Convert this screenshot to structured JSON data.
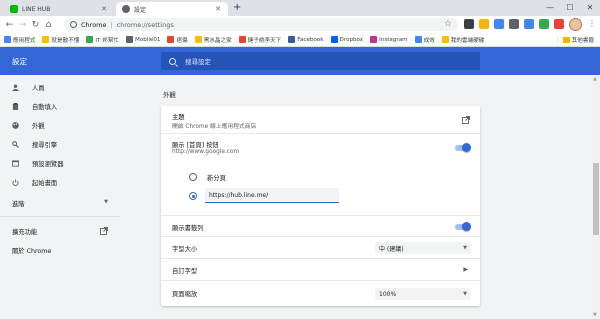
{
  "tabs": [
    {
      "title": "LINE HUB",
      "favicon_color": "#00b900"
    },
    {
      "title": "設定",
      "favicon_color": "#5f6368"
    }
  ],
  "toolbar": {
    "omnibox_site": "Chrome",
    "omnibox_url": "chrome://settings"
  },
  "bookmarks": [
    {
      "label": "應用程式",
      "color": "#4285f4"
    },
    {
      "label": "就是散不懂",
      "color": "#fbbc04"
    },
    {
      "label": "IT 邦幫忙",
      "color": "#34a853"
    },
    {
      "label": "Mobile01",
      "color": "#5f6368"
    },
    {
      "label": "痞傷",
      "color": "#ea4335"
    },
    {
      "label": "黑水晶之家",
      "color": "#fbbc04"
    },
    {
      "label": "鏈子桃李天下",
      "color": "#ea4335"
    },
    {
      "label": "Facebook",
      "color": "#3b5998"
    },
    {
      "label": "Dropbox",
      "color": "#0061ff"
    },
    {
      "label": "Instagram",
      "color": "#c13584"
    },
    {
      "label": "成效",
      "color": "#4285f4"
    },
    {
      "label": "我的雲端硬碟",
      "color": "#fbbc04"
    }
  ],
  "bookmarks_other": "其他書籤",
  "header": {
    "title": "設定",
    "search_placeholder": "搜尋設定"
  },
  "sidebar": {
    "items": [
      {
        "label": "人員",
        "icon": "person-icon"
      },
      {
        "label": "自動填入",
        "icon": "clipboard-icon"
      },
      {
        "label": "外觀",
        "icon": "palette-icon"
      },
      {
        "label": "搜尋引擎",
        "icon": "search-icon"
      },
      {
        "label": "預設瀏覽器",
        "icon": "browser-icon"
      },
      {
        "label": "起始畫面",
        "icon": "power-icon"
      }
    ],
    "advanced": "進階",
    "extensions": "擴充功能",
    "about": "關於 Chrome"
  },
  "appearance": {
    "section_title": "外觀",
    "theme_label": "主題",
    "theme_sub": "開啟 Chrome 線上應用程式商店",
    "home_label": "顯示 [首頁] 按鈕",
    "home_sub": "http://www.google.com",
    "new_tab_option": "新分頁",
    "home_url_value": "https://hub.line.me/",
    "bookmarks_bar_label": "顯示書籤列",
    "font_size_label": "字型大小",
    "font_size_value": "中 (建議)",
    "custom_fonts_label": "自訂字型",
    "zoom_label": "頁面縮放",
    "zoom_value": "100%"
  }
}
